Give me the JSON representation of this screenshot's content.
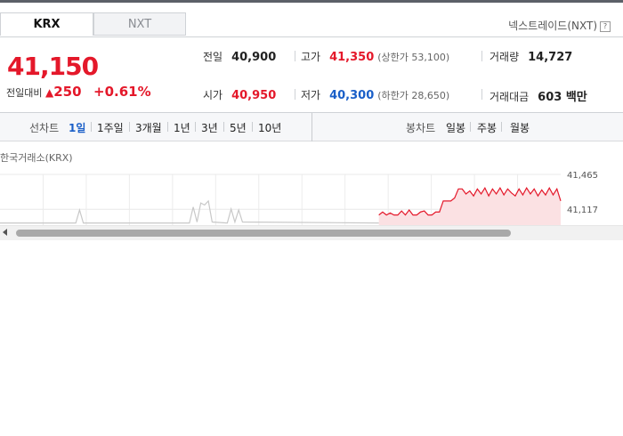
{
  "tabs": [
    {
      "label": "KRX"
    },
    {
      "label": "NXT"
    }
  ],
  "nxt_link": {
    "label": "넥스트레이드(NXT)",
    "help_icon": "?"
  },
  "quote": {
    "price": "41,150",
    "change_label": "전일대비",
    "change_direction": "up",
    "change_amount": "250",
    "change_percent": "+0.61%"
  },
  "stats": {
    "prev_close": {
      "label": "전일",
      "value": "40,900"
    },
    "high": {
      "label": "고가",
      "value": "41,350",
      "sub": "(상한가 53,100)"
    },
    "volume": {
      "label": "거래량",
      "value": "14,727"
    },
    "open": {
      "label": "시가",
      "value": "40,950"
    },
    "low": {
      "label": "저가",
      "value": "40,300",
      "sub": "(하한가 28,650)"
    },
    "amount": {
      "label": "거래대금",
      "value": "603 백만"
    }
  },
  "period_bar": {
    "line_label": "선차트",
    "line_periods": [
      "1일",
      "1주일",
      "3개월",
      "1년",
      "3년",
      "5년",
      "10년"
    ],
    "active": "1일",
    "candle_label": "봉차트",
    "candle_periods": [
      "일봉",
      "주봉",
      "월봉"
    ]
  },
  "chart_title": "한국거래소(KRX)",
  "colors": {
    "up": "#e4182a",
    "down": "#1a5fc8",
    "active_tab": "#1a5fc8"
  },
  "chart_data": {
    "type": "line",
    "y_tick_labels": [
      "41,465",
      "41,117"
    ],
    "ylim": [
      40950,
      41465
    ],
    "grid": true,
    "series": [
      {
        "segment": "prior_session",
        "color": "#c8c8c8",
        "points": [
          [
            0,
            40980
          ],
          [
            20,
            40980
          ],
          [
            21,
            41110
          ],
          [
            22,
            40980
          ],
          [
            50,
            40980
          ],
          [
            51,
            41140
          ],
          [
            52,
            40990
          ],
          [
            53,
            41180
          ],
          [
            54,
            41160
          ],
          [
            55,
            41200
          ],
          [
            56,
            40990
          ],
          [
            60,
            40980
          ],
          [
            61,
            41120
          ],
          [
            62,
            40990
          ],
          [
            63,
            41110
          ],
          [
            64,
            40990
          ],
          [
            100,
            40980
          ]
        ]
      },
      {
        "segment": "today",
        "color": "#e4182a",
        "points": [
          [
            100,
            41060
          ],
          [
            101,
            41090
          ],
          [
            102,
            41060
          ],
          [
            103,
            41080
          ],
          [
            104,
            41060
          ],
          [
            105,
            41060
          ],
          [
            106,
            41100
          ],
          [
            107,
            41060
          ],
          [
            108,
            41110
          ],
          [
            109,
            41060
          ],
          [
            110,
            41060
          ],
          [
            111,
            41090
          ],
          [
            112,
            41100
          ],
          [
            113,
            41060
          ],
          [
            114,
            41060
          ],
          [
            115,
            41090
          ],
          [
            116,
            41090
          ],
          [
            117,
            41200
          ],
          [
            118,
            41200
          ],
          [
            119,
            41200
          ],
          [
            120,
            41230
          ],
          [
            121,
            41320
          ],
          [
            122,
            41320
          ],
          [
            123,
            41270
          ],
          [
            124,
            41300
          ],
          [
            125,
            41250
          ],
          [
            126,
            41320
          ],
          [
            127,
            41270
          ],
          [
            128,
            41330
          ],
          [
            129,
            41250
          ],
          [
            130,
            41320
          ],
          [
            131,
            41270
          ],
          [
            132,
            41330
          ],
          [
            133,
            41260
          ],
          [
            134,
            41320
          ],
          [
            135,
            41280
          ],
          [
            136,
            41250
          ],
          [
            137,
            41320
          ],
          [
            138,
            41260
          ],
          [
            139,
            41330
          ],
          [
            140,
            41270
          ],
          [
            141,
            41320
          ],
          [
            142,
            41250
          ],
          [
            143,
            41310
          ],
          [
            144,
            41260
          ],
          [
            145,
            41330
          ],
          [
            146,
            41260
          ],
          [
            147,
            41320
          ],
          [
            148,
            41200
          ]
        ]
      }
    ]
  }
}
